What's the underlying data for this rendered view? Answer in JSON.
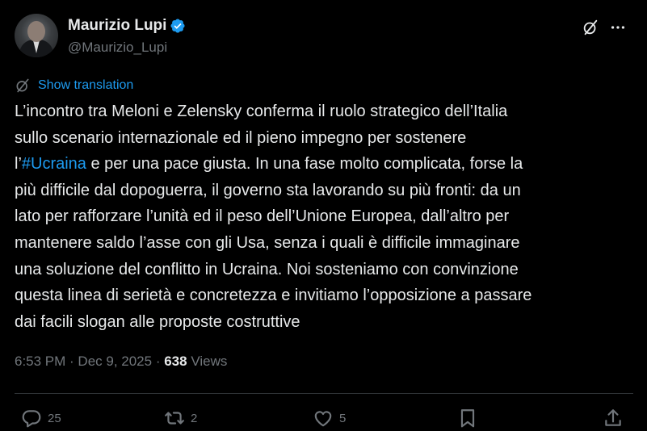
{
  "author": {
    "display_name": "Maurizio Lupi",
    "handle": "@Maurizio_Lupi",
    "verified": true
  },
  "translate": {
    "label": "Show translation"
  },
  "post": {
    "lines": [
      {
        "text": "L’incontro tra Meloni e Zelensky conferma il ruolo strategico dell’Italia"
      },
      {
        "text": "sullo scenario internazionale ed il pieno impegno per sostenere"
      },
      {
        "pre": "l’",
        "hashtag": "#Ucraina",
        "post": " e per una pace giusta. In una fase molto complicata, forse la"
      },
      {
        "text": "più difficile dal dopoguerra, il governo sta lavorando su più fronti: da un"
      },
      {
        "text": "lato per rafforzare l’unità ed il peso dell’Unione Europea, dall’altro per"
      },
      {
        "text": "mantenere saldo l’asse con gli Usa, senza i quali è difficile immaginare"
      },
      {
        "text": "una soluzione del conflitto in Ucraina. Noi sosteniamo con convinzione"
      },
      {
        "text": "questa linea di serietà e concretezza e invitiamo l’opposizione a passare"
      },
      {
        "text": "dai facili slogan alle proposte costruttive"
      }
    ]
  },
  "meta": {
    "time": "6:53 PM",
    "separator": " · ",
    "date": "Dec 9, 2025",
    "views_count": "638",
    "views_label": " Views"
  },
  "actions": {
    "replies": "25",
    "reposts": "2",
    "likes": "5"
  },
  "colors": {
    "background": "#000000",
    "text": "#e7e9ea",
    "muted": "#71767b",
    "accent": "#1d9bf0",
    "divider": "#2f3336"
  },
  "icons": [
    "verified-badge-icon",
    "grok-icon",
    "more-icon",
    "translate-icon",
    "reply-icon",
    "repost-icon",
    "like-icon",
    "bookmark-icon",
    "share-icon"
  ]
}
